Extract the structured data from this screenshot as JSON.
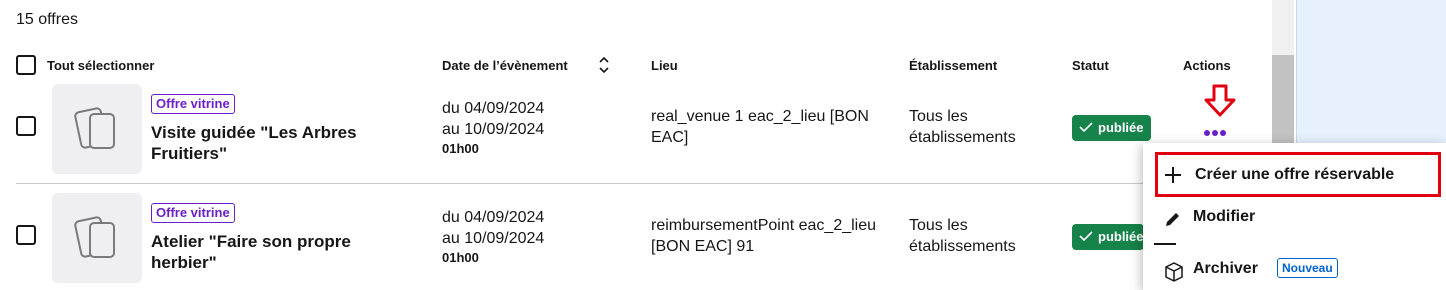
{
  "offers_count": "15 offres",
  "header": {
    "select_all": "Tout sélectionner",
    "date": "Date de l’évènement",
    "lieu": "Lieu",
    "etablissement": "Établissement",
    "statut": "Statut",
    "actions": "Actions"
  },
  "rows": [
    {
      "badge": "Offre vitrine",
      "title": "Visite guidée \"Les Arbres Fruitiers\"",
      "date_from": "du 04/09/2024",
      "date_to": "au 10/09/2024",
      "hour": "01h00",
      "lieu": "real_venue 1 eac_2_lieu [BON EAC]",
      "etablissement": "Tous les établissements",
      "status": "publiée"
    },
    {
      "badge": "Offre vitrine",
      "title": "Atelier \"Faire son propre herbier\"",
      "date_from": "du 04/09/2024",
      "date_to": "au 10/09/2024",
      "hour": "01h00",
      "lieu": "reimbursementPoint eac_2_lieu [BON EAC] 91",
      "etablissement": "Tous les établissements",
      "status": "publiée"
    }
  ],
  "menu": {
    "create": "Créer une offre réservable",
    "edit": "Modifier",
    "archive": "Archiver",
    "archive_badge": "Nouveau"
  },
  "colors": {
    "accent": "#6b1fc8",
    "status_green": "#16834a",
    "highlight_red": "#e1000f",
    "new_badge_blue": "#0063cb"
  },
  "icons": [
    "sort-icon",
    "image-placeholder-icon",
    "check-icon",
    "more-dots-icon",
    "down-arrow-icon",
    "plus-icon",
    "pencil-icon",
    "archive-box-icon"
  ]
}
